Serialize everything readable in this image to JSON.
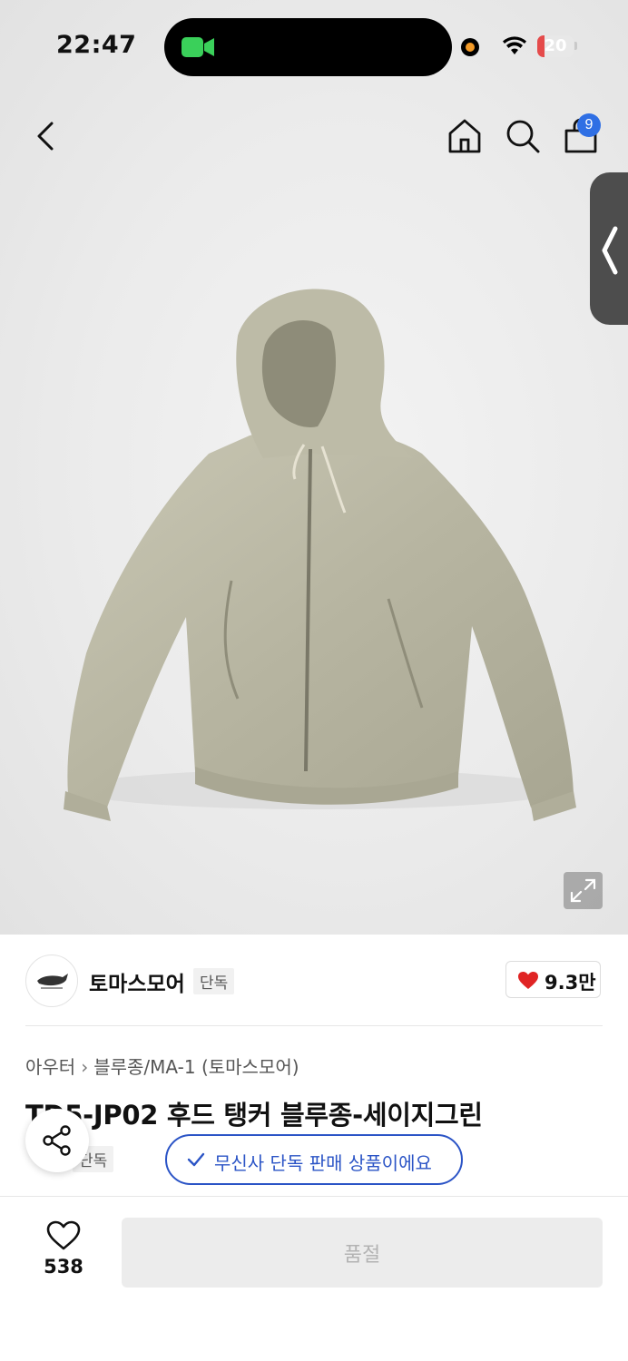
{
  "status_bar": {
    "time": "22:47",
    "battery_level": "20",
    "battery_fraction": 0.2,
    "battery_color": "#e54b4b",
    "camera_indicator_color": "#3ad05a",
    "recording_dot_color": "#f39a27"
  },
  "header": {
    "back_icon": "chevron-left-icon",
    "home_icon": "home-icon",
    "search_icon": "search-icon",
    "cart_icon": "shopping-bag-icon",
    "cart_count": "9"
  },
  "product_image": {
    "alt": "hooded jacket photo",
    "expand_icon": "expand-icon",
    "side_panel_icon": "chevron-left-icon"
  },
  "brand": {
    "name": "토마스모어",
    "tag": "단독",
    "likes": "9.3만",
    "heart_color": "#e02424"
  },
  "breadcrumb": {
    "category": "아우터",
    "subcategory": "블루종/MA-1 (토마스모어)"
  },
  "product": {
    "title": "TD5-JP02 후드 탱커 블루종-세이지그린",
    "exclusive_tag": "단독",
    "exclusive_message": "무신사 단독 판매 상품이에요",
    "accent_color": "#2b54c6"
  },
  "bottom_bar": {
    "wish_count": "538",
    "soldout_label": "품절"
  }
}
